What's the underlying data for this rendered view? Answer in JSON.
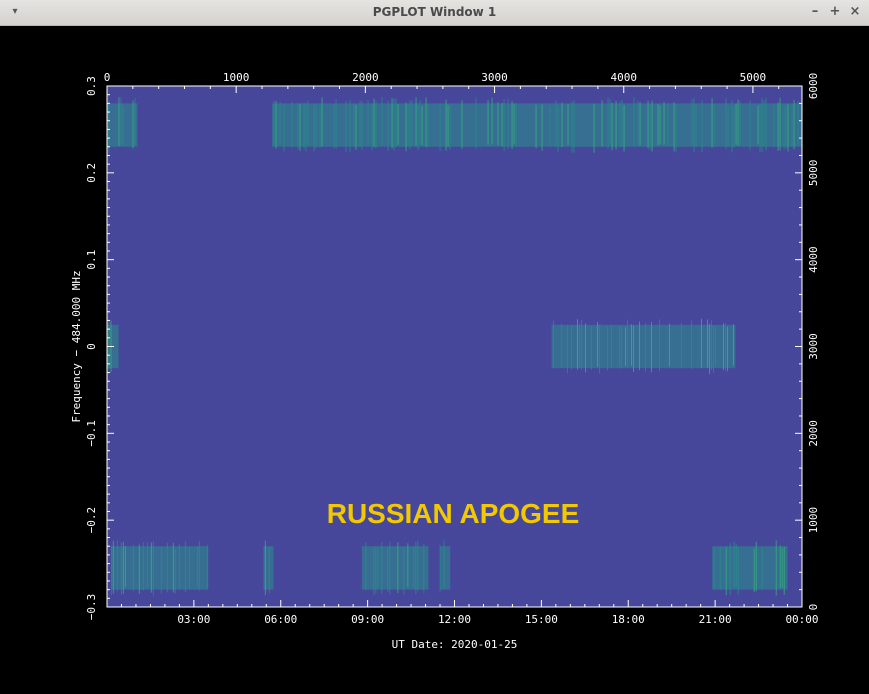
{
  "window": {
    "title": "PGPLOT Window 1",
    "menu_icon": "chevron-down-icon",
    "minimize_label": "–",
    "maximize_label": "+",
    "close_label": "×"
  },
  "annotation": "RUSSIAN APOGEE",
  "colors": {
    "background": "#46479a",
    "signal_low": "#2a8f8a",
    "signal_mid": "#36b87c",
    "signal_high": "#eaea3a"
  },
  "chart_data": {
    "type": "heatmap",
    "title": "",
    "xlabel": "UT Date: 2020-01-25",
    "ylabel": "Frequency − 484.000 MHz",
    "x_bottom_ticks": [
      "03:00",
      "06:00",
      "09:00",
      "12:00",
      "15:00",
      "18:00",
      "21:00",
      "00:00"
    ],
    "x_top_ticks": [
      "0",
      "1000",
      "2000",
      "3000",
      "4000",
      "5000"
    ],
    "y_left_ticks": [
      "0.3",
      "0.2",
      "0.1",
      "0",
      "−0.1",
      "−0.2",
      "−0.3"
    ],
    "y_right_ticks": [
      "6000",
      "5000",
      "4000",
      "3000",
      "2000",
      "1000",
      "0"
    ],
    "xlim_hours": [
      0,
      24
    ],
    "ylim": [
      -0.3,
      0.3
    ],
    "signals": [
      {
        "band": 0.255,
        "t_start": 0.0,
        "t_end": 1.05,
        "intensity": 0.9
      },
      {
        "band": 0.255,
        "t_start": 5.7,
        "t_end": 24.0,
        "intensity": 0.85
      },
      {
        "band": 0.0,
        "t_start": 0.0,
        "t_end": 0.4,
        "intensity": 0.8
      },
      {
        "band": 0.0,
        "t_start": 15.35,
        "t_end": 21.7,
        "intensity": 0.85
      },
      {
        "band": -0.255,
        "t_start": 0.15,
        "t_end": 3.5,
        "intensity": 0.75
      },
      {
        "band": -0.255,
        "t_start": 5.4,
        "t_end": 5.75,
        "intensity": 0.6
      },
      {
        "band": -0.255,
        "t_start": 8.8,
        "t_end": 11.1,
        "intensity": 0.75
      },
      {
        "band": -0.255,
        "t_start": 11.5,
        "t_end": 11.85,
        "intensity": 0.8
      },
      {
        "band": -0.255,
        "t_start": 20.9,
        "t_end": 23.5,
        "intensity": 0.7
      }
    ]
  }
}
